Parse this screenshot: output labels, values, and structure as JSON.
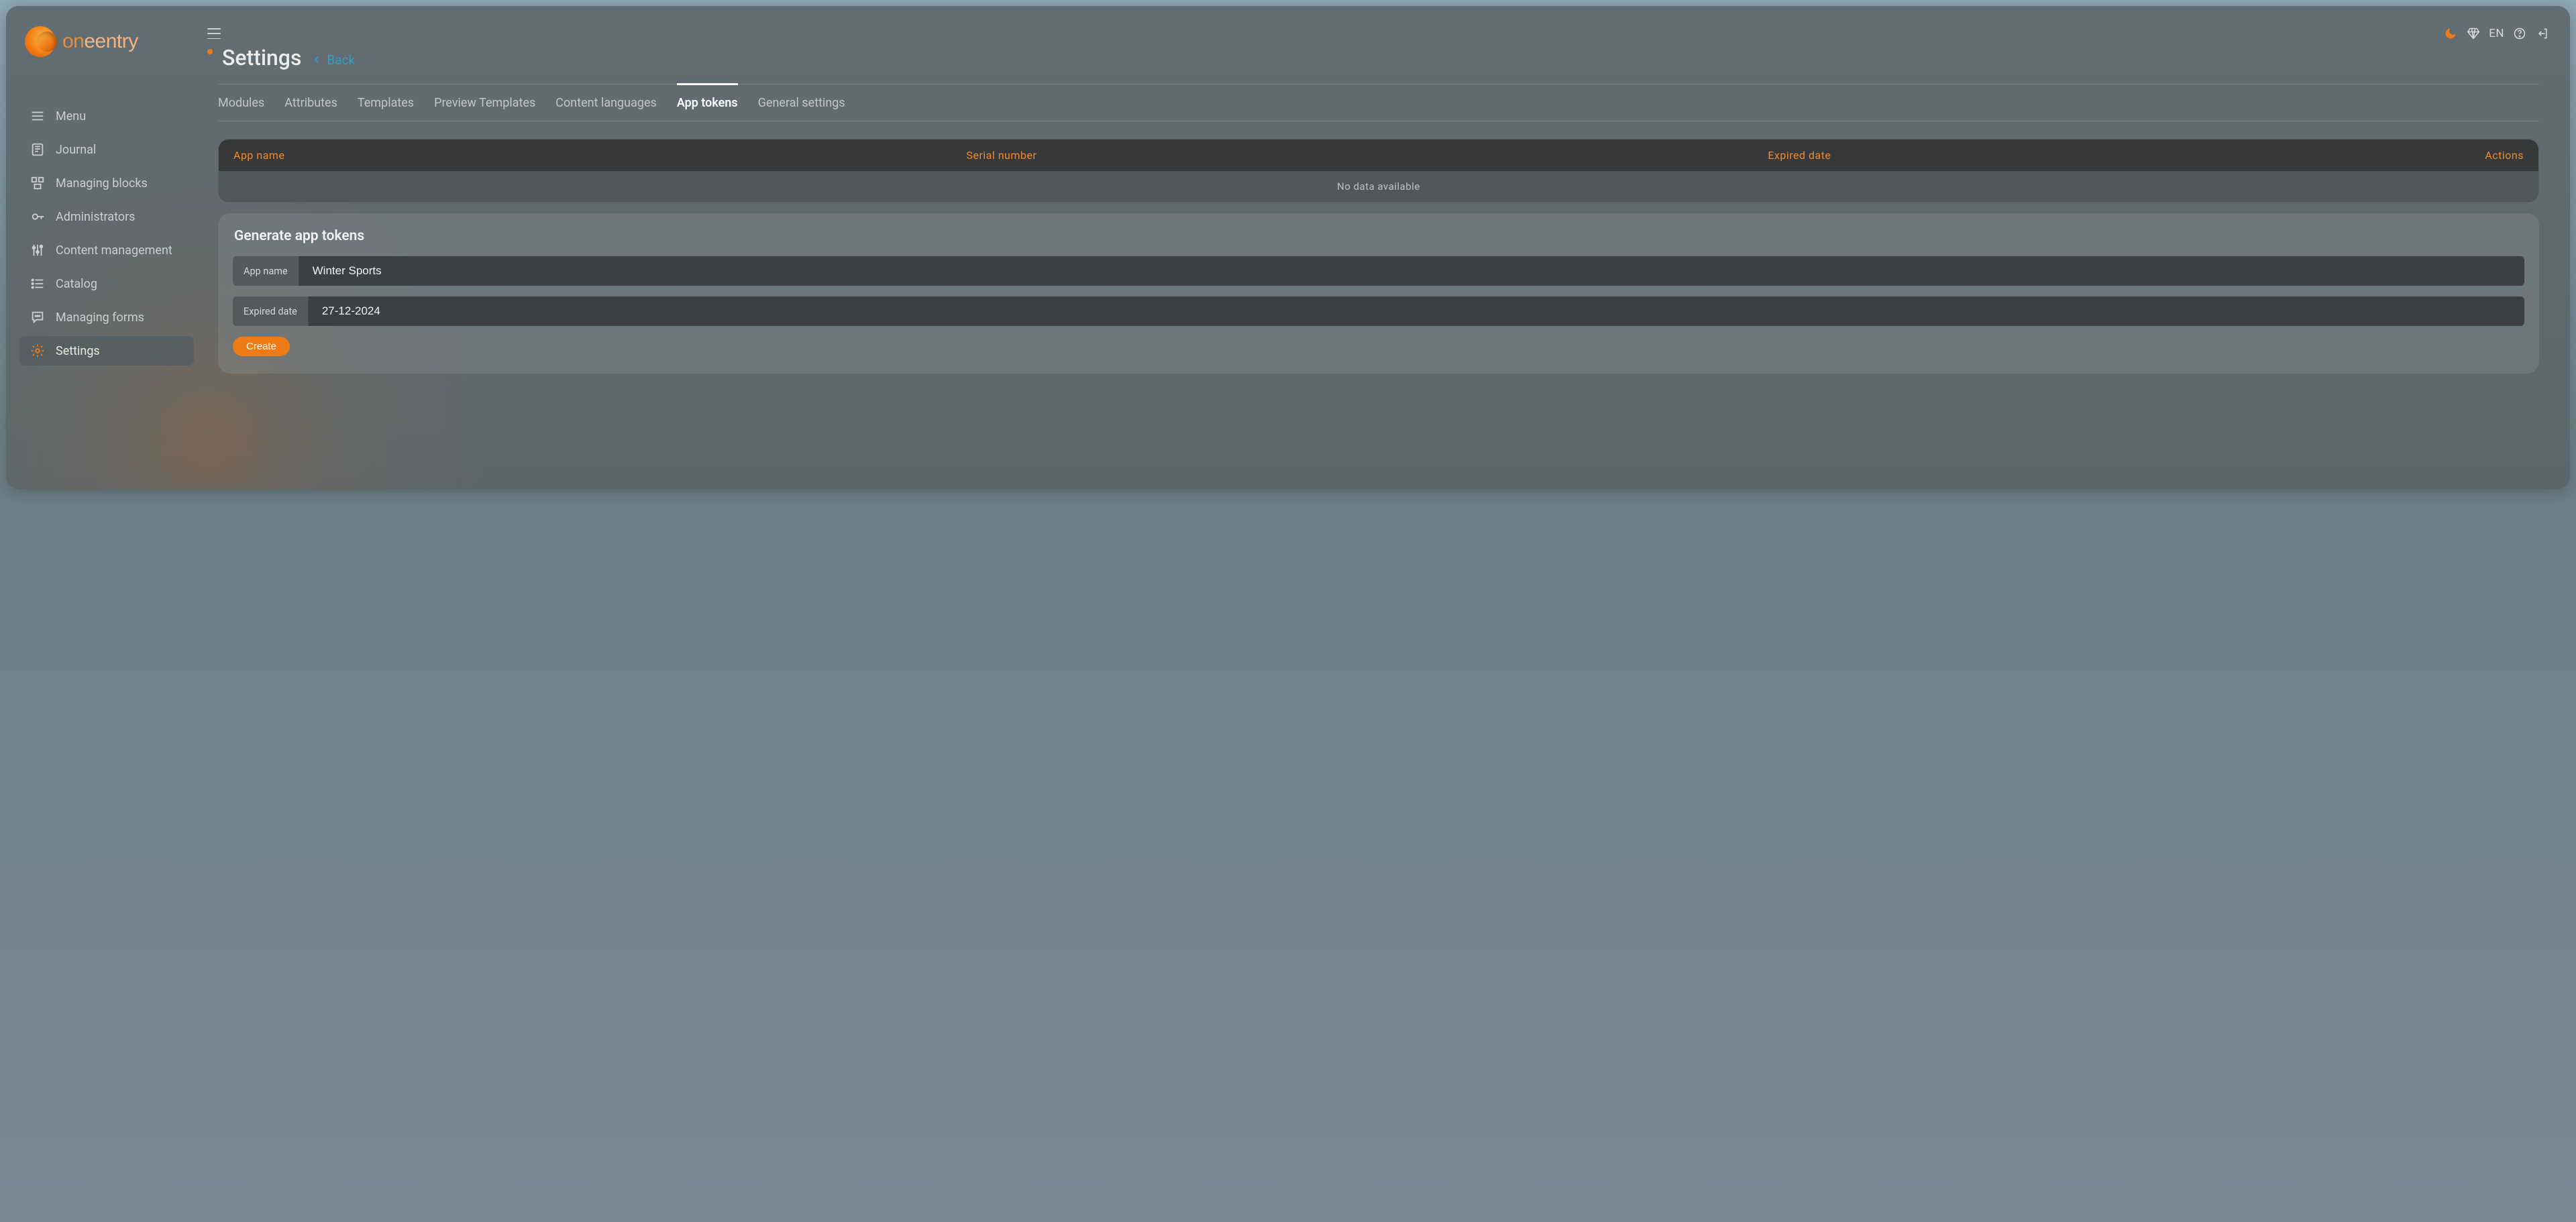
{
  "brand": {
    "name_a": "on",
    "name_b": "eentry"
  },
  "header": {
    "language": "EN"
  },
  "sidebar": {
    "items": [
      {
        "label": "Menu",
        "icon": "menu"
      },
      {
        "label": "Journal",
        "icon": "journal"
      },
      {
        "label": "Managing blocks",
        "icon": "blocks"
      },
      {
        "label": "Administrators",
        "icon": "key"
      },
      {
        "label": "Content management",
        "icon": "sliders"
      },
      {
        "label": "Catalog",
        "icon": "list"
      },
      {
        "label": "Managing forms",
        "icon": "chat"
      },
      {
        "label": "Settings",
        "icon": "gear",
        "active": true
      }
    ]
  },
  "page": {
    "title": "Settings",
    "back_label": "Back"
  },
  "tabs": [
    {
      "label": "Modules"
    },
    {
      "label": "Attributes"
    },
    {
      "label": "Templates"
    },
    {
      "label": "Preview Templates"
    },
    {
      "label": "Content languages"
    },
    {
      "label": "App tokens",
      "active": true
    },
    {
      "label": "General settings"
    }
  ],
  "table": {
    "columns": {
      "app_name": "App name",
      "serial": "Serial number",
      "expired": "Expired date",
      "actions": "Actions"
    },
    "empty_text": "No data available"
  },
  "form": {
    "title": "Generate app tokens",
    "app_name_label": "App name",
    "app_name_value": "Winter Sports",
    "expired_label": "Expired date",
    "expired_value": "27-12-2024",
    "create_label": "Create"
  }
}
